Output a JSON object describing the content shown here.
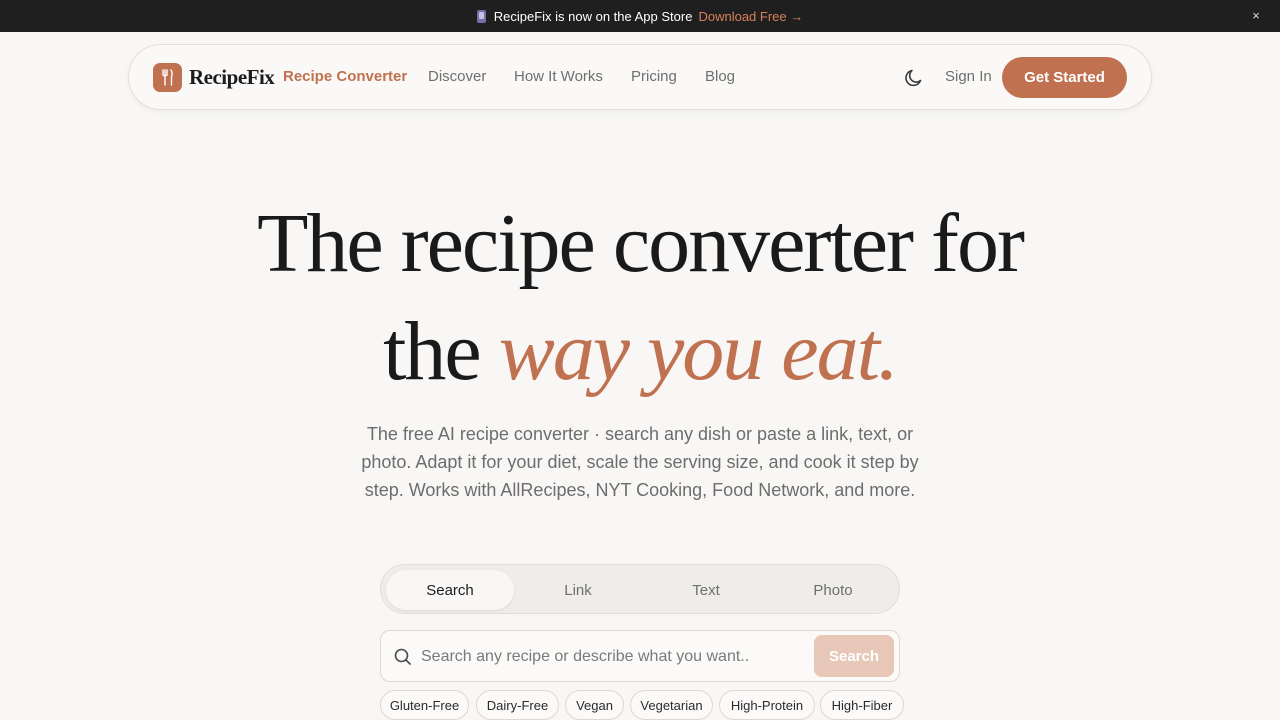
{
  "banner": {
    "message": "RecipeFix is now on the App Store",
    "link": "Download Free →",
    "close": "×"
  },
  "nav": {
    "brand": "RecipeFix",
    "links": [
      "Recipe Converter",
      "Discover",
      "How It Works",
      "Pricing",
      "Blog"
    ],
    "active_link": "Recipe Converter",
    "sign_in": "Sign In",
    "cta": "Get Started",
    "theme_icon": "moon-icon"
  },
  "hero": {
    "title_line1": "The recipe converter for",
    "title_line2_plain": "the",
    "title_line2_accent": "way you eat.",
    "subtitle": "The free AI recipe converter · search any dish or paste a link, text, or photo. Adapt it for your diet, scale the serving size, and cook it step by step. Works with AllRecipes, NYT Cooking, Food Network, and more."
  },
  "input_tabs": {
    "items": [
      "Search",
      "Link",
      "Text",
      "Photo"
    ],
    "active": "Search"
  },
  "search": {
    "placeholder": "Search any recipe or describe what you want..",
    "value": "",
    "button": "Search"
  },
  "diet_chips": [
    "Gluten-Free",
    "Dairy-Free",
    "Vegan",
    "Vegetarian",
    "High-Protein",
    "High-Fiber"
  ],
  "colors": {
    "accent": "#c0714f",
    "banner_bg": "#1f1f1f",
    "page_bg": "#f8f7f5",
    "search_button_bg": "#e6c7b8"
  }
}
